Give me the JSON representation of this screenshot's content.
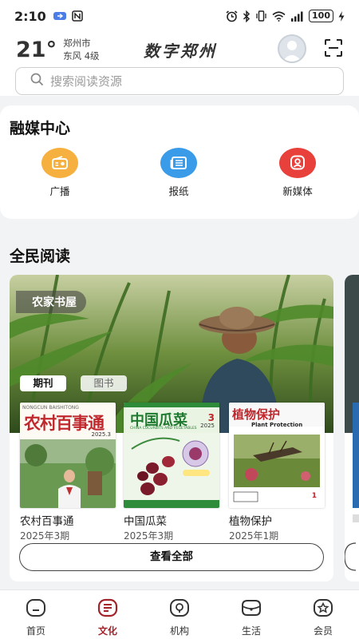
{
  "status_bar": {
    "time": "2:10",
    "battery": "100"
  },
  "header": {
    "temperature": "21°",
    "city": "郑州市",
    "wind": "东风  4级",
    "app_title": "数字郑州"
  },
  "search": {
    "placeholder": "搜索阅读资源"
  },
  "media_center": {
    "title": "融媒中心",
    "items": [
      {
        "label": "广播",
        "icon": "radio-icon",
        "color": "#f6b040"
      },
      {
        "label": "报纸",
        "icon": "newspaper-icon",
        "color": "#3a9be8"
      },
      {
        "label": "新媒体",
        "icon": "new-media-icon",
        "color": "#e8403a"
      }
    ]
  },
  "reading": {
    "title": "全民阅读",
    "card_label": "农家书屋",
    "tabs": [
      "期刊",
      "图书"
    ],
    "books": [
      {
        "name": "农村百事通",
        "issue": "2025年3期",
        "cover_title": "农村百事通",
        "cover_subtitle": "NONGCUN BAISHITONG",
        "cover_issue": "2025.3"
      },
      {
        "name": "中国瓜菜",
        "issue": "2025年3期",
        "cover_title": "中国瓜菜",
        "cover_subtitle": "CHINA CUCURBITS AND VEGETABLES",
        "cover_issue": "3",
        "cover_year": "2025"
      },
      {
        "name": "植物保护",
        "issue": "2025年1期",
        "cover_title": "植物保护",
        "cover_subtitle": "Plant Protection",
        "cover_issue": "1"
      }
    ],
    "view_all": "查看全部"
  },
  "bottom_nav": {
    "items": [
      {
        "label": "首页",
        "icon": "home-icon",
        "active": false
      },
      {
        "label": "文化",
        "icon": "culture-icon",
        "active": true
      },
      {
        "label": "机构",
        "icon": "institution-icon",
        "active": false
      },
      {
        "label": "生活",
        "icon": "life-icon",
        "active": false
      },
      {
        "label": "会员",
        "icon": "member-icon",
        "active": false
      }
    ]
  },
  "colors": {
    "accent": "#a3232b",
    "radio": "#f6b040",
    "newspaper": "#3a9be8",
    "new_media": "#e8403a"
  }
}
